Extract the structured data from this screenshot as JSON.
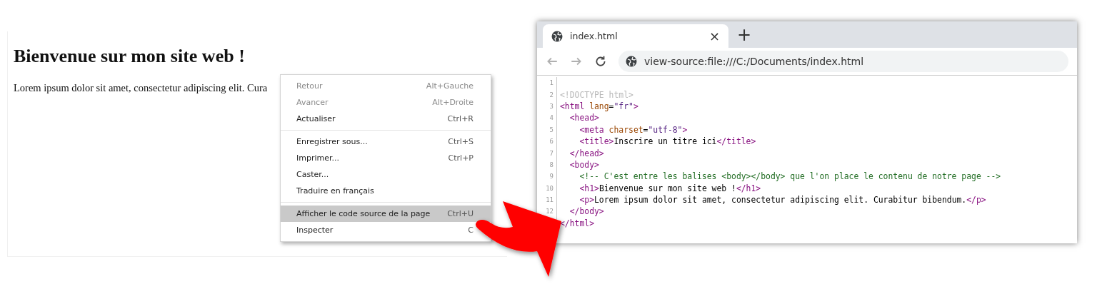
{
  "web_page": {
    "heading": "Bienvenue sur mon site web !",
    "paragraph": "Lorem ipsum dolor sit amet, consectetur adipiscing elit. Cura"
  },
  "context_menu": {
    "groups": [
      [
        {
          "label": "Retour",
          "shortcut": "Alt+Gauche",
          "disabled": true,
          "selected": false
        },
        {
          "label": "Avancer",
          "shortcut": "Alt+Droite",
          "disabled": true,
          "selected": false
        },
        {
          "label": "Actualiser",
          "shortcut": "Ctrl+R",
          "disabled": false,
          "selected": false
        }
      ],
      [
        {
          "label": "Enregistrer sous...",
          "shortcut": "Ctrl+S",
          "disabled": false,
          "selected": false
        },
        {
          "label": "Imprimer...",
          "shortcut": "Ctrl+P",
          "disabled": false,
          "selected": false
        },
        {
          "label": "Caster...",
          "disabled": false,
          "selected": false
        },
        {
          "label": "Traduire en français",
          "disabled": false,
          "selected": false
        }
      ],
      [
        {
          "label": "Afficher le code source de la page",
          "shortcut": "Ctrl+U",
          "disabled": false,
          "selected": true
        },
        {
          "label": "Inspecter",
          "shortcut": "C",
          "disabled": false,
          "selected": false
        }
      ]
    ]
  },
  "browser": {
    "tab": {
      "title": "index.html",
      "close": "×"
    },
    "new_tab": "+",
    "nav_buttons": [
      {
        "kind": "back",
        "disabled": true
      },
      {
        "kind": "forward",
        "disabled": true
      },
      {
        "kind": "reload",
        "disabled": false
      }
    ],
    "address": "view-source:file:///C:/Documents/index.html",
    "source_lines": [
      {
        "number": "1"
      },
      {
        "number": "2",
        "tokens": [
          {
            "kind": "doctype",
            "text": "<!DOCTYPE html>"
          }
        ]
      },
      {
        "number": "3",
        "tokens": [
          {
            "kind": "tag",
            "text": "<html"
          },
          {
            "kind": "attr",
            "text": " lang"
          },
          {
            "kind": "text",
            "text": "="
          },
          {
            "kind": "value",
            "text": "\"fr\""
          },
          {
            "kind": "tag",
            "text": ">"
          }
        ]
      },
      {
        "number": "4",
        "tokens": [
          {
            "kind": "tag",
            "text": "  <head>"
          }
        ]
      },
      {
        "number": "5",
        "tokens": [
          {
            "kind": "tag",
            "text": "    <meta"
          },
          {
            "kind": "attr",
            "text": " charset"
          },
          {
            "kind": "text",
            "text": "="
          },
          {
            "kind": "value",
            "text": "\"utf-8\""
          },
          {
            "kind": "tag",
            "text": ">"
          }
        ]
      },
      {
        "number": "6",
        "tokens": [
          {
            "kind": "tag",
            "text": "    <title>"
          },
          {
            "kind": "text",
            "text": "Inscrire un titre ici"
          },
          {
            "kind": "tag",
            "text": "</title>"
          }
        ]
      },
      {
        "number": "7",
        "tokens": [
          {
            "kind": "tag",
            "text": "  </head>"
          }
        ]
      },
      {
        "number": "8",
        "tokens": [
          {
            "kind": "tag",
            "text": "  <body>"
          }
        ]
      },
      {
        "number": "9",
        "tokens": [
          {
            "kind": "comment",
            "text": "    <!-- C'est entre les balises <body></body> que l'on place le contenu de notre page -->"
          }
        ]
      },
      {
        "number": "10",
        "tokens": [
          {
            "kind": "tag",
            "text": "    <h1>"
          },
          {
            "kind": "text",
            "text": "Bienvenue sur mon site web !"
          },
          {
            "kind": "tag",
            "text": "</h1>"
          }
        ]
      },
      {
        "number": "11",
        "tokens": [
          {
            "kind": "tag",
            "text": "    <p>"
          },
          {
            "kind": "text",
            "text": "Lorem ipsum dolor sit amet, consectetur adipiscing elit. Curabitur bibendum."
          },
          {
            "kind": "tag",
            "text": "</p>"
          }
        ]
      },
      {
        "number": "12",
        "tokens": [
          {
            "kind": "tag",
            "text": "  </body>"
          }
        ]
      },
      {
        "tokens": [
          {
            "kind": "tag",
            "text": "</html>"
          }
        ]
      }
    ]
  }
}
